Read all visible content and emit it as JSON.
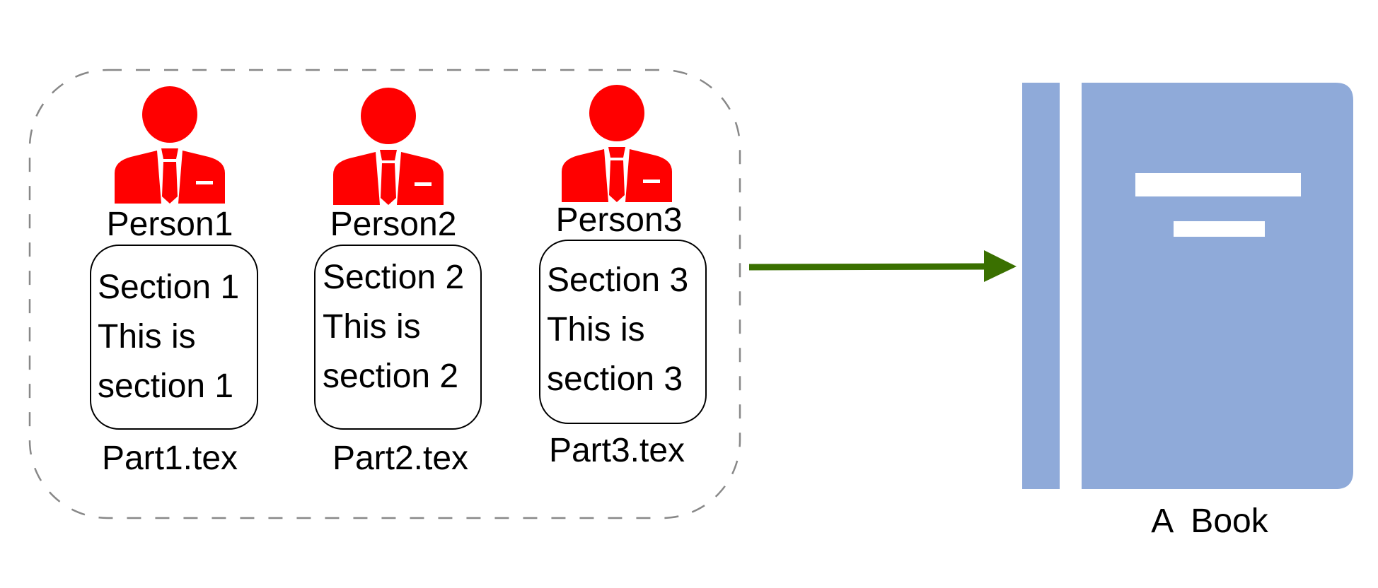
{
  "diagram": {
    "group": {
      "border_color": "#888888",
      "persons": [
        {
          "name": "Person1",
          "section_lines": [
            "Section 1",
            "This is",
            "section 1"
          ],
          "file": "Part1.tex"
        },
        {
          "name": "Person2",
          "section_lines": [
            "Section 2",
            "This is",
            "section 2"
          ],
          "file": "Part2.tex"
        },
        {
          "name": "Person3",
          "section_lines": [
            "Section 3",
            "This is",
            "section 3"
          ],
          "file": "Part3.tex"
        }
      ]
    },
    "person_icon": {
      "icon": "person-in-suit-icon",
      "color": "#ff0000"
    },
    "arrow": {
      "color": "#3a7000",
      "direction": "right"
    },
    "book": {
      "icon": "book-icon",
      "color": "#8faad9",
      "label": "A  Book"
    }
  }
}
